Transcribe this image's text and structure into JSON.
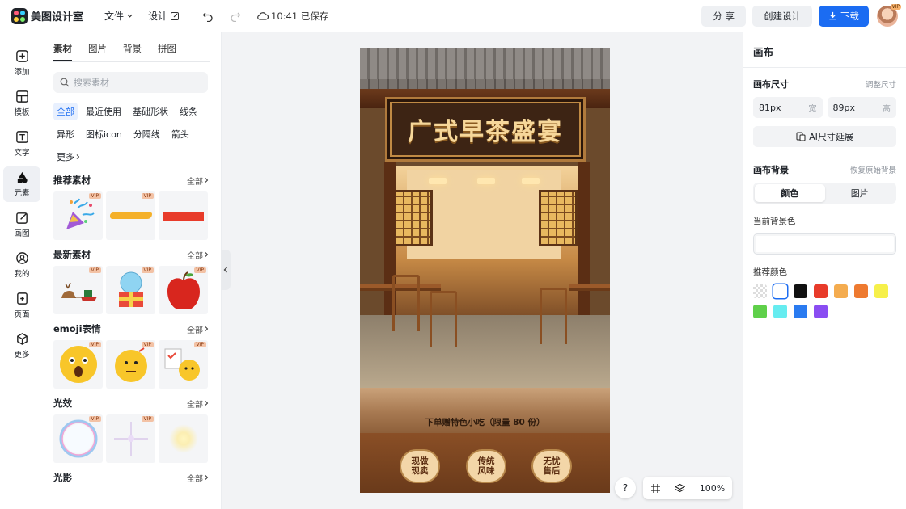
{
  "app": {
    "name": "美图设计室"
  },
  "topbar": {
    "file_menu": "文件",
    "design_menu": "设计",
    "save_status": "10:41 已保存",
    "share": "分 享",
    "create_design": "创建设计",
    "download": "下载",
    "avatar_vip": "VIP"
  },
  "rail": {
    "items": [
      {
        "label": "添加",
        "icon": "plus-square-icon"
      },
      {
        "label": "模板",
        "icon": "template-grid-icon"
      },
      {
        "label": "文字",
        "icon": "text-t-icon"
      },
      {
        "label": "元素",
        "icon": "shapes-icon"
      },
      {
        "label": "画图",
        "icon": "pen-edit-icon"
      },
      {
        "label": "我的",
        "icon": "user-icon"
      },
      {
        "label": "页面",
        "icon": "page-add-icon"
      },
      {
        "label": "更多",
        "icon": "cube-icon"
      }
    ],
    "active_index": 3
  },
  "panel": {
    "tabs": [
      "素材",
      "图片",
      "背景",
      "拼图"
    ],
    "search_placeholder": "搜索素材",
    "chips": [
      "全部",
      "最近使用",
      "基础形状",
      "线条",
      "异形",
      "图标icon",
      "分隔线",
      "箭头",
      "更多"
    ],
    "all_label": "全部",
    "vip_tag": "VIP",
    "sections": [
      {
        "title": "推荐素材",
        "items": [
          "party-popper",
          "yellow-brush-stroke",
          "red-rectangle"
        ]
      },
      {
        "title": "最新素材",
        "items": [
          "reindeer-sleigh",
          "snow-globe-gift",
          "red-apple"
        ]
      },
      {
        "title": "emoji表情",
        "items": [
          "shocked-emoji",
          "thinking-emoji",
          "checklist-emoji"
        ]
      },
      {
        "title": "光效",
        "items": [
          "bubble-ring",
          "sparkle-star",
          "soft-glow"
        ]
      },
      {
        "title": "光影",
        "items": []
      }
    ]
  },
  "canvas": {
    "sign_text": "广式早茶盛宴",
    "ribbon_text": "下单赠特色小吃（限量 80 份）",
    "badges": [
      "现做\n现卖",
      "传统\n风味",
      "无忧\n售后"
    ]
  },
  "bottom_tools": {
    "help": "?",
    "zoom": "100%"
  },
  "rpanel": {
    "title": "画布",
    "canvas_size_label": "画布尺寸",
    "adjust_size": "调整尺寸",
    "width_value": "81px",
    "width_unit": "宽",
    "height_value": "89px",
    "height_unit": "高",
    "ai_extend": "AI尺寸延展",
    "bg_label": "画布背景",
    "restore_bg": "恢复原始背景",
    "seg_color": "颜色",
    "seg_image": "图片",
    "current_bg_label": "当前背景色",
    "recommended_label": "推荐颜色",
    "swatches": [
      "transparent",
      "#ffffff",
      "#111111",
      "#e83b2a",
      "#f4ac4f",
      "#ee7a30",
      "#f6f04a",
      "#5fd04a",
      "#66ecf0",
      "#2a7bf0",
      "#8a4df2"
    ]
  }
}
